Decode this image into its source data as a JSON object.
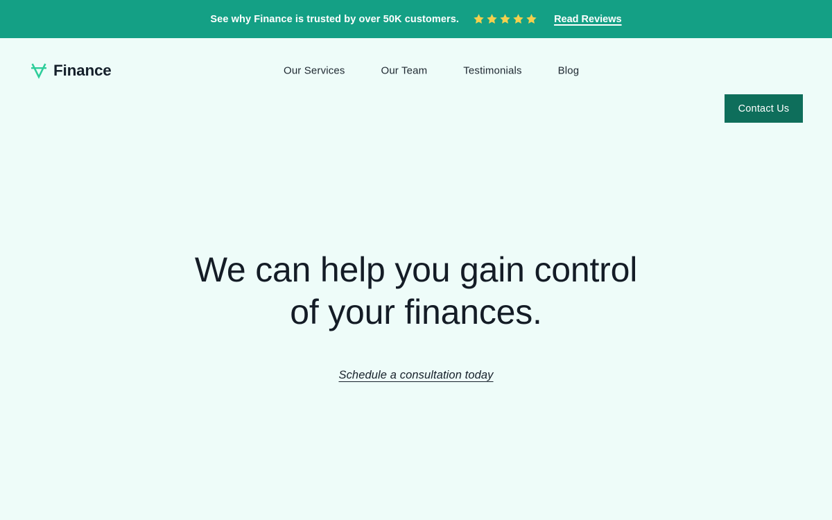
{
  "announcement": {
    "text": "See why Finance is trusted by over 50K customers.",
    "rating": 5,
    "star_count": 5,
    "star_icon": "star-icon",
    "star_color": "#F3D04E",
    "link_label": "Read Reviews",
    "background_color": "#14A085",
    "text_color": "#FFFFFF"
  },
  "header": {
    "brand": {
      "logo_icon": "finance-v-logomark-icon",
      "logo_color": "#2ECE9B",
      "name": "Finance"
    },
    "nav": [
      {
        "label": "Our Services"
      },
      {
        "label": "Our Team"
      },
      {
        "label": "Testimonials"
      },
      {
        "label": "Blog"
      }
    ],
    "cta": {
      "label": "Contact Us",
      "background_color": "#0E6E5B",
      "text_color": "#FFFFFF"
    }
  },
  "hero": {
    "title_line_1": "We can help you gain control",
    "title_line_2": "of your finances.",
    "title": "We can help you gain control of your finances.",
    "cta_label": "Schedule a consultation today",
    "background_color": "#EEFCF9",
    "text_color": "#141C26"
  }
}
